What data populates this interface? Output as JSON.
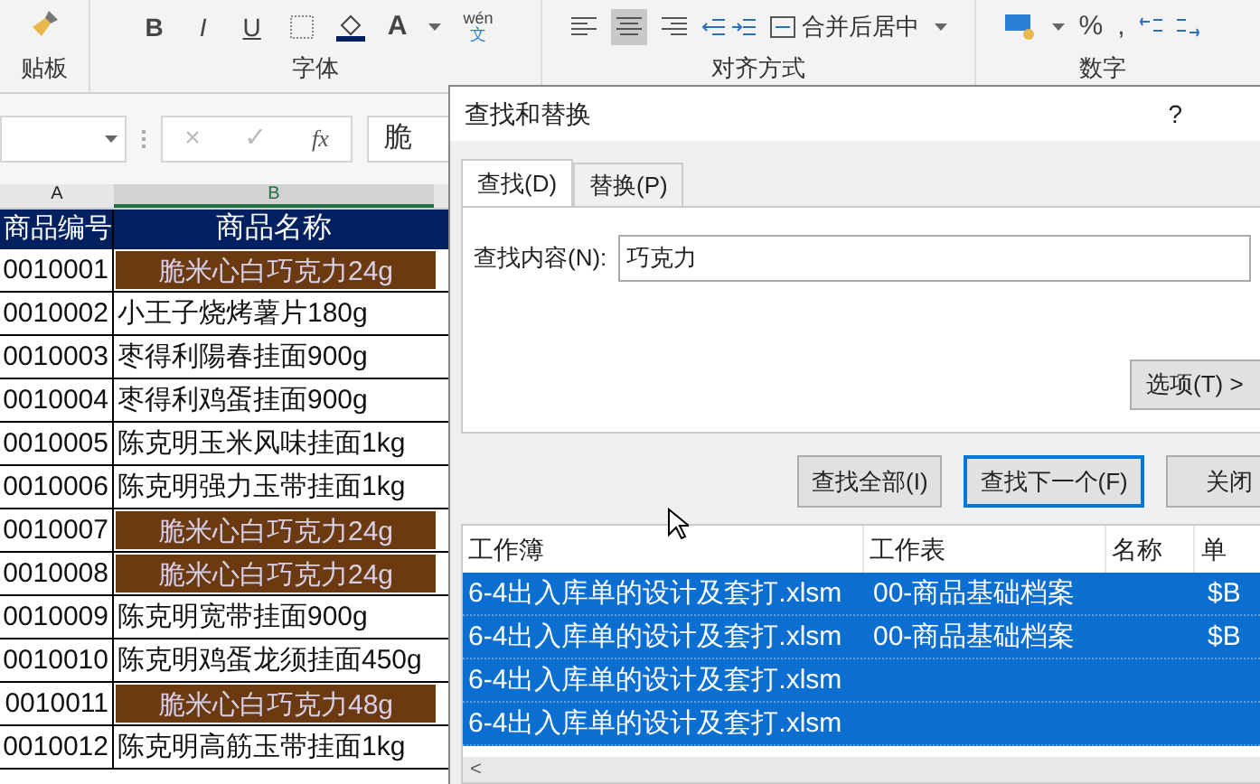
{
  "ribbon": {
    "groups": [
      {
        "label": "贴板"
      },
      {
        "label": "字体"
      },
      {
        "label": "对齐方式"
      },
      {
        "label": "数字"
      }
    ],
    "font_buttons": [
      "B",
      "I",
      "U",
      "A"
    ],
    "phonetic_guide": {
      "pinyin": "wén",
      "character": "文"
    },
    "merge_button": "合并后居中",
    "number_buttons": [
      "%",
      ","
    ]
  },
  "formula_bar": {
    "cancel": "×",
    "confirm": "✓",
    "function_label": "fx",
    "value": "脆"
  },
  "sheet": {
    "column_headers": [
      {
        "label": "A",
        "selected": false
      },
      {
        "label": "B",
        "selected": true
      }
    ],
    "header_row": [
      "商品编号",
      "商品名称"
    ],
    "rows": [
      {
        "code": "0010001",
        "name": "脆米心白巧克力24g",
        "highlighted": true
      },
      {
        "code": "0010002",
        "name": "小王子烧烤薯片180g",
        "highlighted": false
      },
      {
        "code": "0010003",
        "name": "枣得利陽春挂面900g",
        "highlighted": false
      },
      {
        "code": "0010004",
        "name": "枣得利鸡蛋挂面900g",
        "highlighted": false
      },
      {
        "code": "0010005",
        "name": "陈克明玉米风味挂面1kg",
        "highlighted": false
      },
      {
        "code": "0010006",
        "name": "陈克明强力玉带挂面1kg",
        "highlighted": false
      },
      {
        "code": "0010007",
        "name": "脆米心白巧克力24g",
        "highlighted": true
      },
      {
        "code": "0010008",
        "name": "脆米心白巧克力24g",
        "highlighted": true
      },
      {
        "code": "0010009",
        "name": "陈克明宽带挂面900g",
        "highlighted": false
      },
      {
        "code": "0010010",
        "name": "陈克明鸡蛋龙须挂面450g",
        "highlighted": false
      },
      {
        "code": "0010011",
        "name": "脆米心白巧克力48g",
        "highlighted": true
      },
      {
        "code": "0010012",
        "name": "陈克明高筋玉带挂面1kg",
        "highlighted": false
      }
    ]
  },
  "dialog": {
    "title": "查找和替换",
    "help": "?",
    "tabs": [
      {
        "label": "查找(D)",
        "selected": true
      },
      {
        "label": "替换(P)",
        "selected": false
      }
    ],
    "find_label": "查找内容(N):",
    "find_value": "巧克力",
    "options_button": "选项(T) >",
    "buttons": [
      {
        "label": "查找全部(I)",
        "default": false
      },
      {
        "label": "查找下一个(F)",
        "default": true
      },
      {
        "label": "关闭",
        "default": false
      }
    ],
    "results": {
      "columns": [
        "工作簿",
        "工作表",
        "名称",
        "单"
      ],
      "rows": [
        {
          "workbook": "6-4出入库单的设计及套打.xlsm",
          "sheet": "00-商品基础档案",
          "cell": "$B",
          "selected": true
        },
        {
          "workbook": "6-4出入库单的设计及套打.xlsm",
          "sheet": "00-商品基础档案",
          "cell": "$B",
          "selected": true
        },
        {
          "workbook": "6-4出入库单的设计及套打.xlsm",
          "selected": true
        },
        {
          "workbook": "6-4出入库单的设计及套打.xlsm",
          "selected": true
        }
      ]
    },
    "scroll_left": "<"
  }
}
